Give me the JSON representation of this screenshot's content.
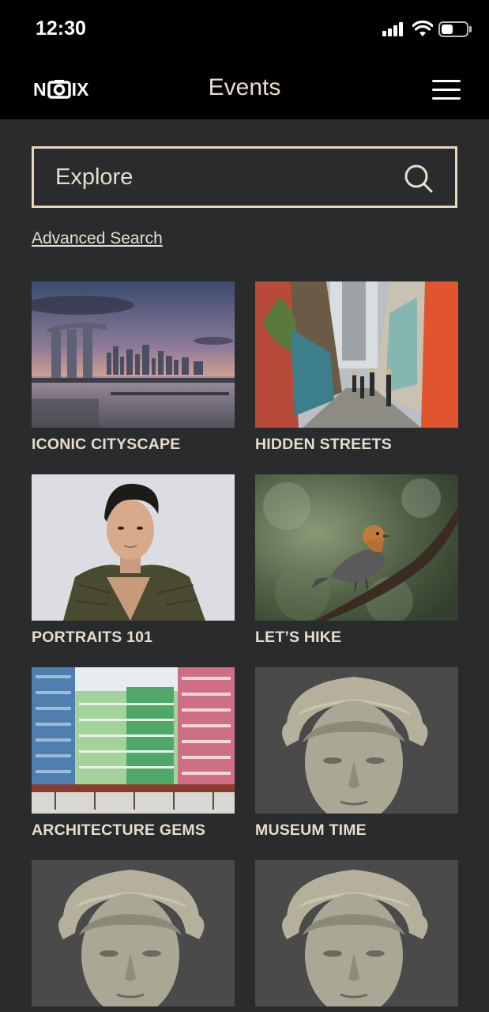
{
  "status_bar": {
    "time": "12:30",
    "battery_level": 0.45
  },
  "header": {
    "logo_text_left": "N",
    "logo_text_right": "IX",
    "title": "Events",
    "menu_icon": "hamburger-menu-icon"
  },
  "search": {
    "placeholder": "Explore",
    "value": "",
    "icon": "search-icon"
  },
  "advanced_search_label": "Advanced Search",
  "events": [
    {
      "label": "ICONIC CITYSCAPE",
      "image": "city-skyline-sunset"
    },
    {
      "label": "HIDDEN STREETS",
      "image": "colorful-shophouse-street"
    },
    {
      "label": "PORTRAITS 101",
      "image": "man-portrait"
    },
    {
      "label": "LET’S HIKE",
      "image": "bird-on-branch"
    },
    {
      "label": "ARCHITECTURE GEMS",
      "image": "colorful-apartment-blocks"
    },
    {
      "label": "MUSEUM TIME",
      "image": "stone-bust-statue"
    },
    {
      "label": "",
      "image": "stone-bust-statue"
    },
    {
      "label": "",
      "image": "stone-bust-statue"
    }
  ],
  "colors": {
    "background": "#2a2b2d",
    "header": "#000000",
    "accent": "#e8d6bd",
    "text": "#e8dccd"
  }
}
